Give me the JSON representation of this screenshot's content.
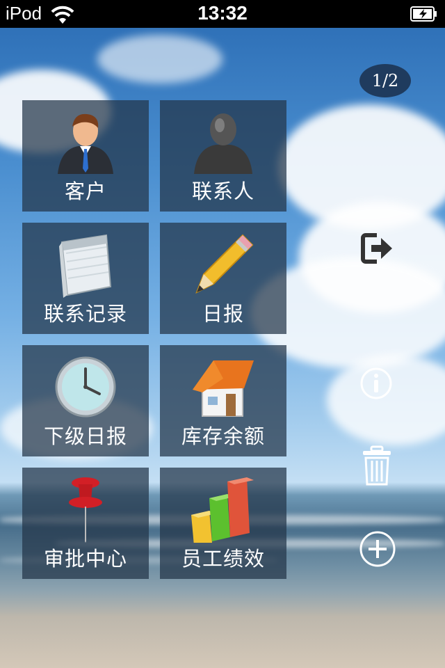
{
  "status_bar": {
    "device": "iPod",
    "time": "13:32"
  },
  "pager": {
    "label": "1/2"
  },
  "menu": {
    "customers": "客户",
    "contacts": "联系人",
    "contact_records": "联系记录",
    "daily_report": "日报",
    "subordinate_daily_report": "下级日报",
    "inventory_balance": "库存余额",
    "approval_center": "审批中心",
    "employee_performance": "员工绩效"
  },
  "icons": [
    "wifi-icon",
    "battery-icon",
    "customer-icon",
    "contact-person-icon",
    "notepad-icon",
    "pencil-icon",
    "clock-icon",
    "house-icon",
    "pushpin-icon",
    "bar-chart-icon",
    "logout-icon",
    "info-icon",
    "trash-icon",
    "add-icon"
  ]
}
